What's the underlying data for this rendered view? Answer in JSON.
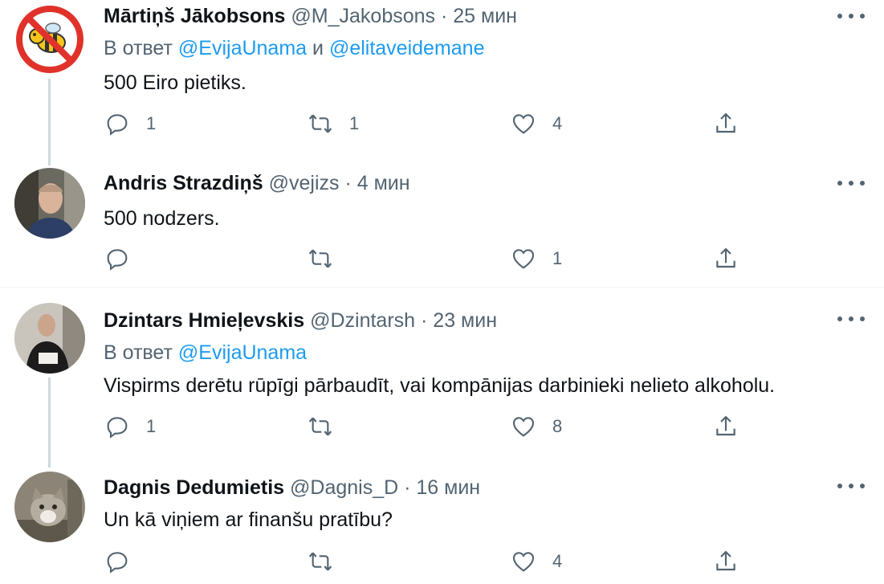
{
  "tweets": [
    {
      "name": "Mārtiņš Jākobsons",
      "handle": "@M_Jakobsons",
      "separator": "·",
      "time": "25 мин",
      "reply_prefix": "В ответ",
      "reply_mention_1": "@EvijaUnama",
      "reply_conj": "и",
      "reply_mention_2": "@elitaveidemane",
      "text": "500 Eiro pietiks.",
      "reply_count": "1",
      "retweet_count": "1",
      "like_count": "4",
      "avatar": "no-bee-sign"
    },
    {
      "name": "Andris Strazdiņš",
      "handle": "@vejizs",
      "separator": "·",
      "time": "4 мин",
      "text": "500 nodzers.",
      "reply_count": "",
      "retweet_count": "",
      "like_count": "1",
      "avatar": "man-portrait"
    },
    {
      "name": "Dzintars Hmieļevskis",
      "handle": "@Dzintarsh",
      "separator": "·",
      "time": "23 мин",
      "reply_prefix": "В ответ",
      "reply_mention_1": "@EvijaUnama",
      "text": "Vispirms derētu rūpīgi pārbaudīt, vai kompānijas darbinieki nelieto alkoholu.",
      "reply_count": "1",
      "retweet_count": "",
      "like_count": "8",
      "avatar": "man-dark-sweater"
    },
    {
      "name": "Dagnis Dedumietis",
      "handle": "@Dagnis_D",
      "separator": "·",
      "time": "16 мин",
      "text": "Un kā viņiem ar finanšu pratību?",
      "reply_count": "",
      "retweet_count": "",
      "like_count": "4",
      "avatar": "cat-photo"
    }
  ],
  "colors": {
    "accent": "#1d9bf0",
    "secondary_text": "#536471",
    "thread_line": "#cfd9de",
    "divider": "#eff3f4"
  },
  "icons": [
    "reply-icon",
    "retweet-icon",
    "like-icon",
    "share-icon",
    "more-icon"
  ]
}
